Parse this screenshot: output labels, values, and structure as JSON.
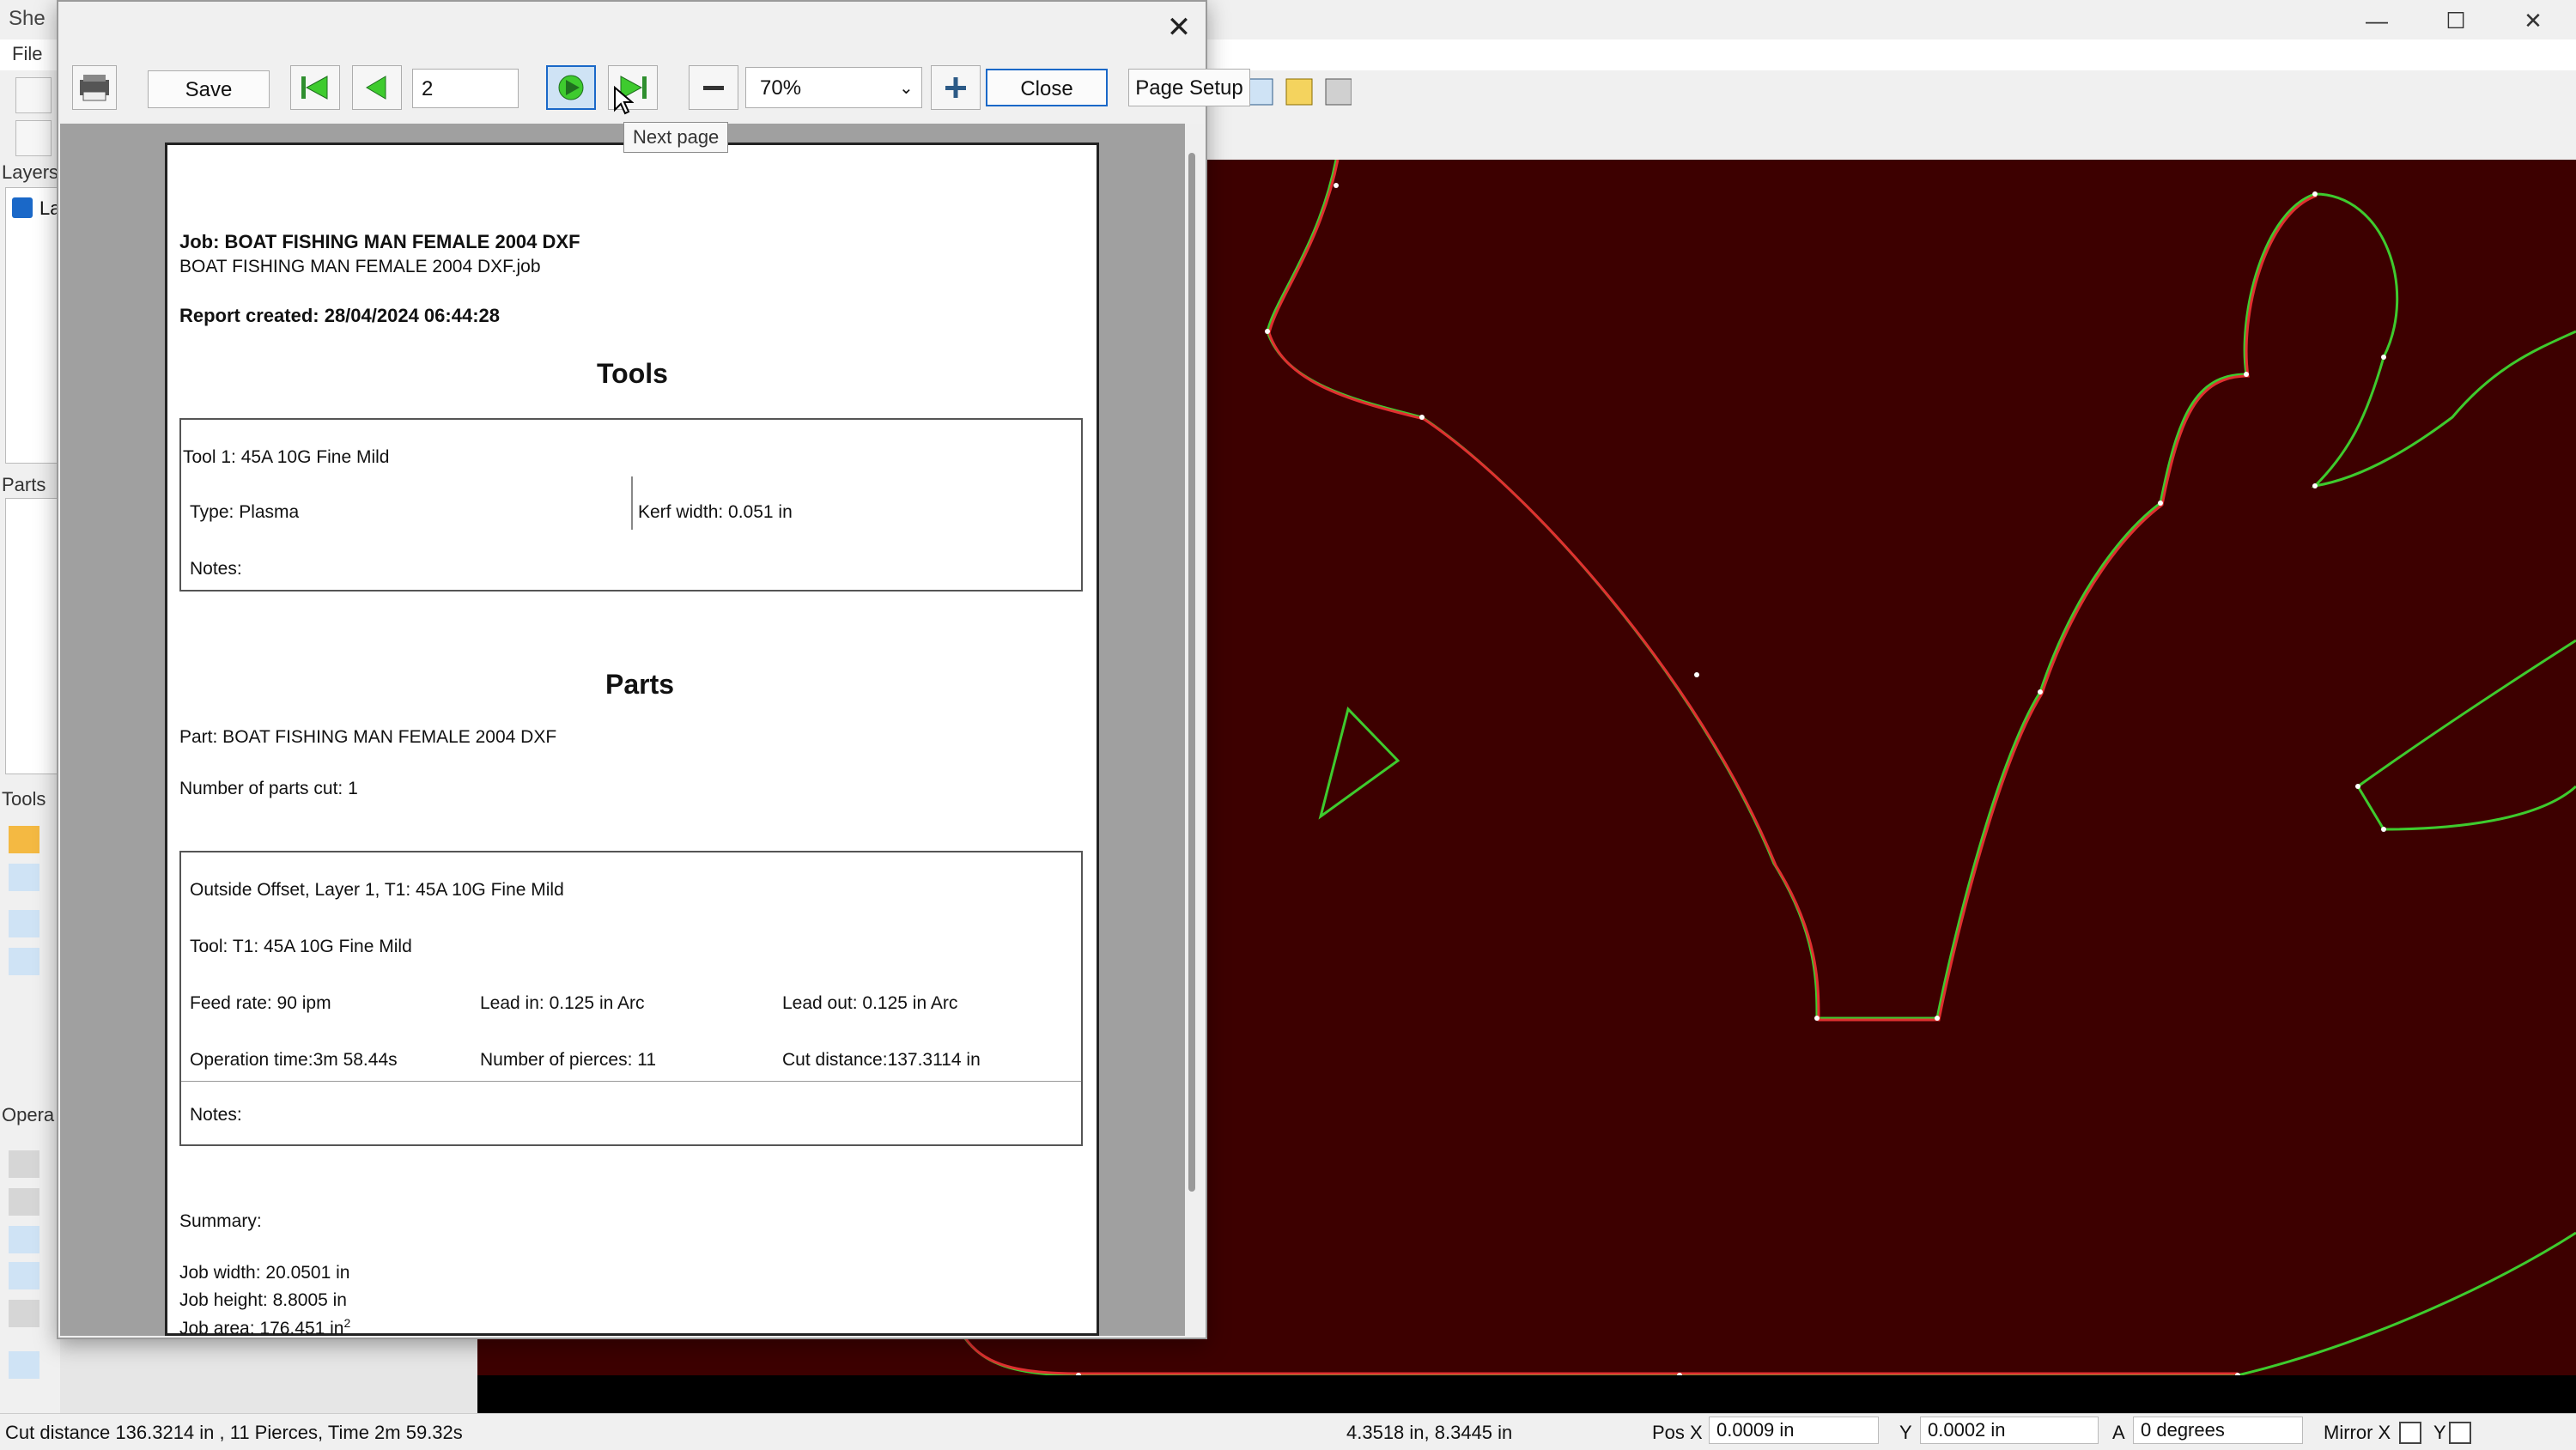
{
  "app": {
    "title": "She",
    "menu_file": "File",
    "side_labels": {
      "layers": "Layers",
      "layer_item": "La",
      "parts": "Parts",
      "tools": "Tools",
      "operations": "Opera"
    },
    "window_controls": {
      "minimize": "—",
      "maximize": "☐",
      "close": "✕"
    }
  },
  "dialog": {
    "close_glyph": "✕",
    "save_label": "Save",
    "page_value": "2",
    "zoom_value": "70%",
    "close_label": "Close",
    "page_setup_label": "Page Setup",
    "tooltip": "Next page",
    "icons": [
      "printer-icon",
      "first-page-icon",
      "previous-page-icon",
      "next-page-icon",
      "last-page-icon",
      "zoom-out-icon",
      "zoom-in-icon"
    ]
  },
  "report": {
    "job_line": "Job: BOAT FISHING MAN FEMALE 2004 DXF",
    "job_file": "BOAT FISHING MAN FEMALE 2004 DXF.job",
    "created": "Report created: 28/04/2024 06:44:28",
    "tools_heading": "Tools",
    "tool_name": "Tool 1: 45A 10G Fine Mild",
    "tool_type": "Type: Plasma",
    "kerf": "Kerf width: 0.051 in",
    "tool_notes": "Notes:",
    "parts_heading": "Parts",
    "part_name": "Part: BOAT FISHING MAN FEMALE 2004 DXF",
    "parts_cut": "Number of parts cut: 1",
    "op_title": "Outside Offset, Layer 1, T1: 45A 10G Fine Mild",
    "op_tool": "Tool: T1: 45A 10G Fine Mild",
    "feed_rate": "Feed rate: 90 ipm",
    "lead_in": "Lead in: 0.125 in Arc",
    "lead_out": "Lead out: 0.125 in Arc",
    "op_time": "Operation time:3m 58.44s",
    "pierces": "Number of pierces: 11",
    "cut_distance": "Cut distance:137.3114 in",
    "op_notes": "Notes:",
    "summary": "Summary:",
    "job_width": "Job width: 20.0501 in",
    "job_height": "Job height: 8.8005 in",
    "job_area": "Job area: 176.451 in",
    "job_area_unit_sup": "2"
  },
  "status": {
    "left_text": "Cut distance 136.3214 in , 11 Pierces, Time 2m 59.32s",
    "cursor_pos": "4.3518 in, 8.3445 in",
    "pos_x_label": "Pos X",
    "pos_x_value": "0.0009 in",
    "y_label": "Y",
    "y_value": "0.0002 in",
    "a_label": "A",
    "a_value": "0 degrees",
    "mirror_x_label": "Mirror X",
    "mirror_y_label": "Y"
  },
  "colors": {
    "canvas": "#3d0000",
    "path_green": "#3ecb2e",
    "path_red": "#e03030",
    "accent_blue": "#1a68c8"
  }
}
